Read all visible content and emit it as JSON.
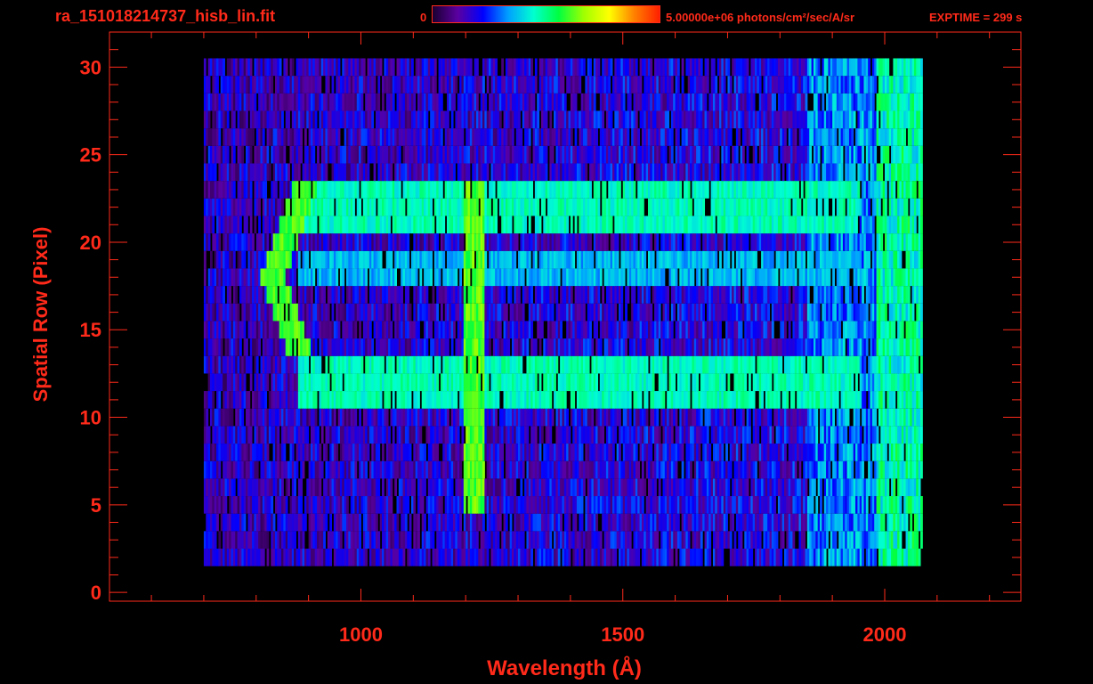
{
  "title": "ra_151018214737_hisb_lin.fit",
  "colorbar": {
    "min_label": "0",
    "max_label": "5.00000e+06 photons/cm²/sec/A/sr",
    "colors": [
      "#1a0030",
      "#5a00a0",
      "#0000ff",
      "#00a0ff",
      "#00ffd0",
      "#00ff40",
      "#a0ff00",
      "#ffff00",
      "#ff8000",
      "#ff2000"
    ]
  },
  "exptime_label": "EXPTIME = 299 s",
  "accent_color": "#ff2a1a",
  "chart_data": {
    "type": "heatmap",
    "title": "ra_151018214737_hisb_lin.fit",
    "xlabel": "Wavelength (Å)",
    "ylabel": "Spatial Row (Pixel)",
    "xlim": [
      520,
      2260
    ],
    "ylim": [
      -0.5,
      32
    ],
    "x_ticks": [
      1000,
      1500,
      2000
    ],
    "y_ticks": [
      0,
      5,
      10,
      15,
      20,
      25,
      30
    ],
    "colorbar_range": [
      0,
      5000000
    ],
    "data_extent": {
      "x": [
        700,
        2070
      ],
      "rows": [
        2,
        30
      ]
    },
    "features": [
      {
        "name": "bright column",
        "x": [
          1195,
          1235
        ],
        "rows": [
          5,
          23
        ],
        "level": 0.6
      },
      {
        "name": "curved arc",
        "x": [
          800,
          940
        ],
        "rows": [
          14,
          23
        ],
        "level": 0.55
      },
      {
        "name": "horizontal band",
        "x": [
          880,
          1950
        ],
        "rows": [
          21,
          23
        ],
        "level": 0.45
      },
      {
        "name": "horizontal band",
        "x": [
          880,
          1950
        ],
        "rows": [
          11,
          13
        ],
        "level": 0.45
      },
      {
        "name": "horizontal band",
        "x": [
          880,
          1950
        ],
        "rows": [
          18,
          19
        ],
        "level": 0.35
      }
    ]
  }
}
